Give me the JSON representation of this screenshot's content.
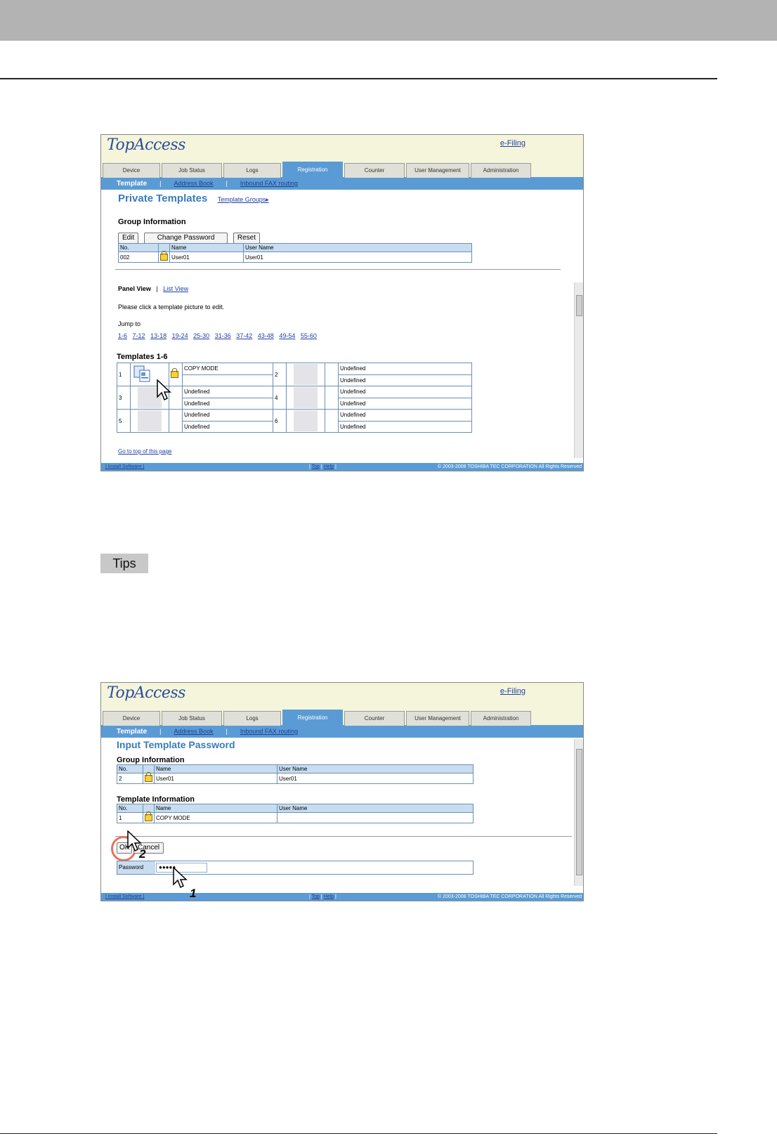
{
  "app": {
    "logo": "TopAccess",
    "efiling": "e-Filing"
  },
  "tabs": [
    "Device",
    "Job Status",
    "Logs",
    "Registration",
    "Counter",
    "User Management",
    "Administration"
  ],
  "subnav": {
    "current": "Template",
    "sep": "|",
    "address_book": "Address Book",
    "inbound_fax": "Inbound FAX routing"
  },
  "footer": {
    "install": "| Install Software |",
    "top": "Top",
    "help": "Help",
    "pipe1": "|",
    "pipe2": "|",
    "pipe3": "|",
    "copyright": "© 2003-2008 TOSHIBA TEC CORPORATION All Rights Reserved"
  },
  "shot1": {
    "title": "Private Templates",
    "template_groups": "Template Groups▸",
    "group_info": "Group Information",
    "buttons": {
      "edit": "Edit",
      "change_password": "Change Password",
      "reset": "Reset"
    },
    "group_headers": [
      "No.",
      "",
      "Name",
      "User Name"
    ],
    "group_row": {
      "no": "002",
      "name": "User01",
      "user": "User01"
    },
    "panel_view": "Panel View",
    "sep": "|",
    "list_view": "List View",
    "instruction": "Please click a template picture to edit.",
    "jump_to": "Jump to",
    "jump_links": [
      "1-6",
      "7-12",
      "13-18",
      "19-24",
      "25-30",
      "31-36",
      "37-42",
      "43-48",
      "49-54",
      "55-60"
    ],
    "templates_title": "Templates 1-6",
    "templates": [
      {
        "no": "1",
        "a": "COPY MODE",
        "b": ""
      },
      {
        "no": "2",
        "a": "Undefined",
        "b": "Undefined"
      },
      {
        "no": "3",
        "a": "Undefined",
        "b": "Undefined"
      },
      {
        "no": "4",
        "a": "Undefined",
        "b": "Undefined"
      },
      {
        "no": "5",
        "a": "Undefined",
        "b": "Undefined"
      },
      {
        "no": "6",
        "a": "Undefined",
        "b": "Undefined"
      }
    ],
    "go_top": "Go to top of this page"
  },
  "tips": "Tips",
  "shot2": {
    "title": "Input Template Password",
    "group_info": "Group Information",
    "group_headers": [
      "No.",
      "",
      "Name",
      "User Name"
    ],
    "group_row": {
      "no": "2",
      "name": "User01",
      "user": "User01"
    },
    "template_info": "Template Information",
    "template_headers": [
      "No.",
      "",
      "Name",
      "User Name"
    ],
    "template_row": {
      "no": "1",
      "name": "COPY MODE",
      "user": ""
    },
    "ok": "OK",
    "cancel": "Cancel",
    "password_label": "Password",
    "password_value": "●●●●●",
    "step1": "1",
    "step2": "2"
  }
}
